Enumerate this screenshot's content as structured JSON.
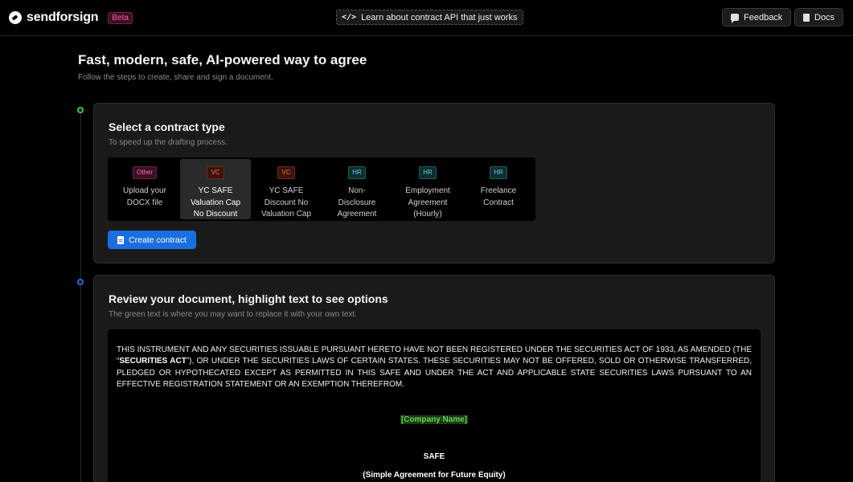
{
  "header": {
    "brand": "sendforsign",
    "beta_label": "Beta",
    "api_link_icon": "</>",
    "api_link_label": "Learn about contract API that just works",
    "feedback_label": "Feedback",
    "docs_label": "Docs"
  },
  "hero": {
    "title": "Fast, modern, safe, AI-powered way to agree",
    "subtitle": "Follow the steps to create, share and sign a document."
  },
  "step1": {
    "title": "Select a contract type",
    "subtitle": "To speed up the drafting process.",
    "types": [
      {
        "tag": "Other",
        "label": "Upload your\nDOCX file"
      },
      {
        "tag": "VC",
        "label": "YC SAFE\nValuation Cap\nNo Discount"
      },
      {
        "tag": "VC",
        "label": "YC SAFE\nDiscount No\nValuation Cap"
      },
      {
        "tag": "HR",
        "label": "Non-\nDisclosure\nAgreement"
      },
      {
        "tag": "HR",
        "label": "Employment\nAgreement\n(Hourly)"
      },
      {
        "tag": "HR",
        "label": "Freelance\nContract"
      }
    ],
    "create_label": "Create contract"
  },
  "step2": {
    "title": "Review your document, highlight text to see options",
    "subtitle": "The green text is where you may want to replace it with your own text.",
    "doc_text_1": "THIS INSTRUMENT AND ANY SECURITIES ISSUABLE PURSUANT HERETO HAVE NOT BEEN REGISTERED UNDER THE SECURITIES ACT OF 1933, AS AMENDED (THE “",
    "doc_text_bold": "SECURITIES ACT",
    "doc_text_2": "”), OR UNDER THE SECURITIES LAWS OF CERTAIN STATES. THESE SECURITIES MAY NOT BE OFFERED, SOLD OR OTHERWISE TRANSFERRED, PLEDGED OR HYPOTHECATED EXCEPT AS PERMITTED IN THIS SAFE AND UNDER THE ACT AND APPLICABLE STATE SECURITIES LAWS PURSUANT TO AN EFFECTIVE REGISTRATION STATEMENT OR AN EXEMPTION THEREFROM.",
    "company_placeholder": "[Company Name]",
    "safe_title": "SAFE",
    "safe_subtitle": "(Simple Agreement for Future Equity)"
  }
}
